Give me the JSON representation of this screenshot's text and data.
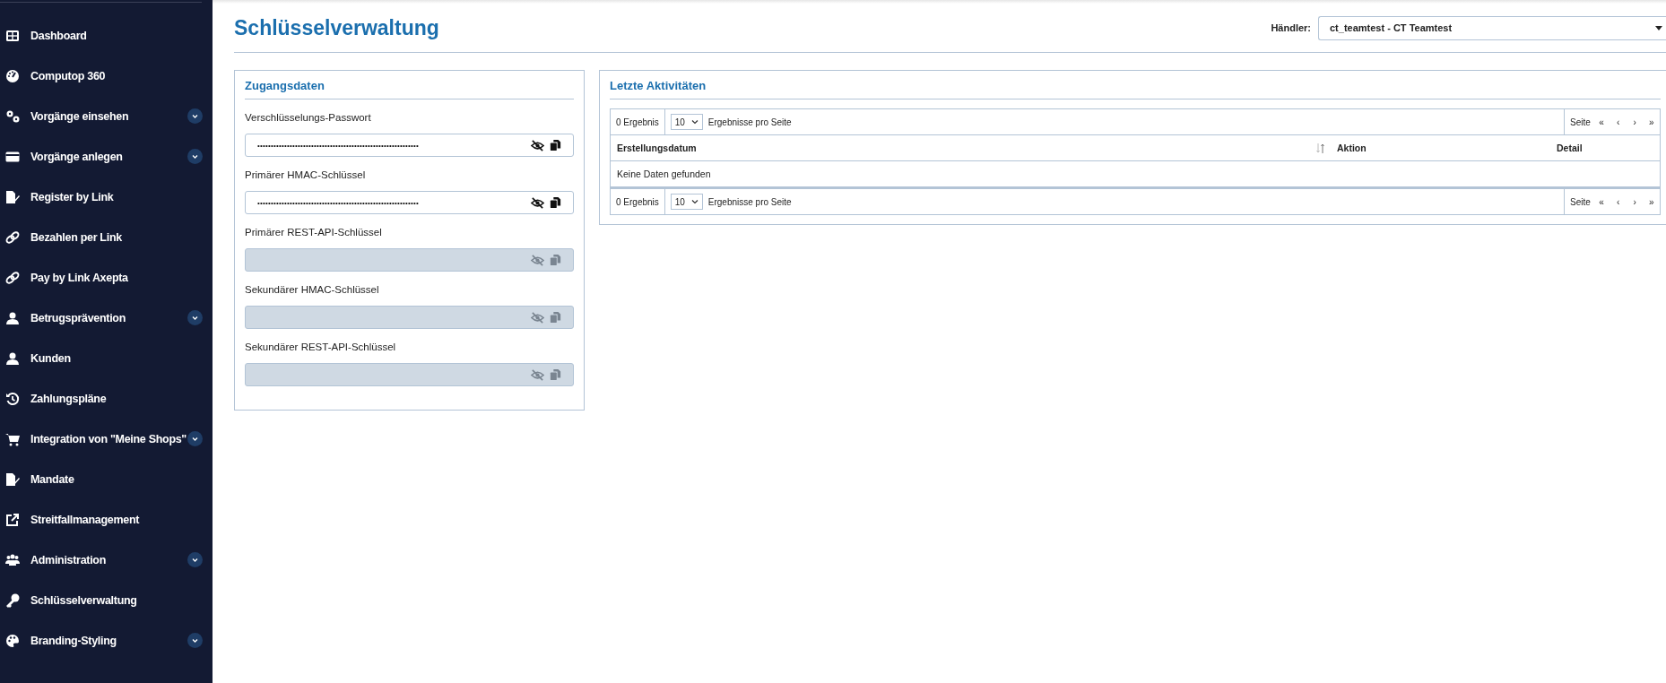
{
  "sidebar": {
    "items": [
      {
        "label": "Dashboard",
        "expandable": false
      },
      {
        "label": "Computop 360",
        "expandable": false
      },
      {
        "label": "Vorgänge einsehen",
        "expandable": true
      },
      {
        "label": "Vorgänge anlegen",
        "expandable": true
      },
      {
        "label": "Register by Link",
        "expandable": false
      },
      {
        "label": "Bezahlen per Link",
        "expandable": false
      },
      {
        "label": "Pay by Link Axepta",
        "expandable": false
      },
      {
        "label": "Betrugsprävention",
        "expandable": true
      },
      {
        "label": "Kunden",
        "expandable": false
      },
      {
        "label": "Zahlungspläne",
        "expandable": false
      },
      {
        "label": "Integration von \"Meine Shops\"",
        "expandable": true
      },
      {
        "label": "Mandate",
        "expandable": false
      },
      {
        "label": "Streitfallmanagement",
        "expandable": false
      },
      {
        "label": "Administration",
        "expandable": true
      },
      {
        "label": "Schlüsselverwaltung",
        "expandable": false
      },
      {
        "label": "Branding-Styling",
        "expandable": true
      }
    ]
  },
  "page_title": "Schlüsselverwaltung",
  "merchant": {
    "label": "Händler:",
    "value": "ct_teamtest - CT Teamtest"
  },
  "credentials": {
    "title": "Zugangsdaten",
    "fields": [
      {
        "label": "Verschlüsselungs-Passwort",
        "value": "••••••••••••••••••••••••••••••••••••••••••••••••••••••••••••",
        "disabled": false
      },
      {
        "label": "Primärer HMAC-Schlüssel",
        "value": "••••••••••••••••••••••••••••••••••••••••••••••••••••••••••••",
        "disabled": false
      },
      {
        "label": "Primärer REST-API-Schlüssel",
        "disabled": true
      },
      {
        "label": "Sekundärer HMAC-Schlüssel",
        "disabled": true
      },
      {
        "label": "Sekundärer REST-API-Schlüssel",
        "disabled": true
      }
    ]
  },
  "activities": {
    "title": "Letzte Aktivitäten",
    "toolbars": [
      {
        "count": "0 Ergebnis",
        "page_size": "10",
        "per_page_label": "Ergebnisse pro Seite",
        "page_label": "Seite",
        "nav": [
          "«",
          "‹",
          "›",
          "»"
        ]
      },
      {
        "count": "0 Ergebnis",
        "page_size": "10",
        "per_page_label": "Ergebnisse pro Seite",
        "page_label": "Seite",
        "nav": [
          "«",
          "‹",
          "›",
          "»"
        ]
      }
    ],
    "columns": [
      {
        "label": "Erstellungsdatum",
        "sortable": true
      },
      {
        "label": "Aktion",
        "sortable": false
      },
      {
        "label": "Detail",
        "sortable": false
      }
    ],
    "empty_message": "Keine Daten gefunden"
  }
}
